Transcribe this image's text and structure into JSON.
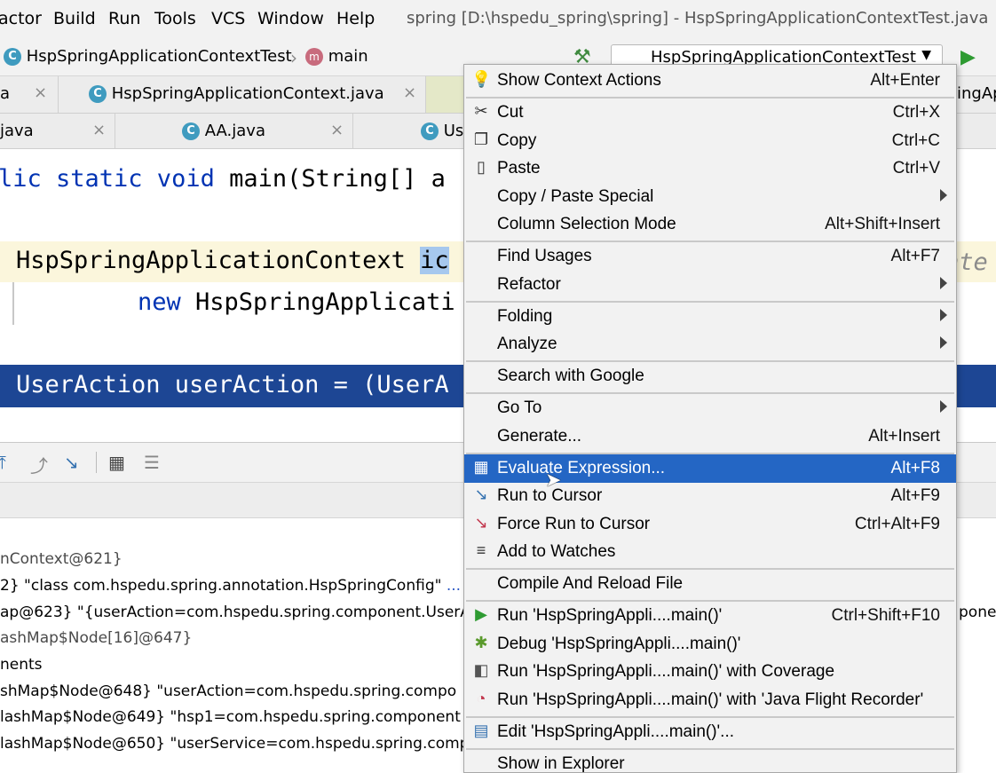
{
  "menubar": {
    "items": [
      "actor",
      "Build",
      "Run",
      "Tools",
      "VCS",
      "Window",
      "Help"
    ],
    "title": "spring [D:\\hspedu_spring\\spring] - HspSpringApplicationContextTest.java"
  },
  "navbar": {
    "crumb1": "HspSpringApplicationContextTest",
    "crumb2": "main",
    "run_config": "HspSpringApplicationContextTest"
  },
  "tabs_row1": [
    {
      "label": "a"
    },
    {
      "label": "HspSpringApplicationContext.java"
    },
    {
      "label": ""
    },
    {
      "label": "ingApp"
    }
  ],
  "tabs_row2": [
    {
      "label": "java"
    },
    {
      "label": "AA.java"
    },
    {
      "label": "Us"
    }
  ],
  "editor": {
    "line1_kw": "lic static void ",
    "line1_rest": "main(String[] a",
    "line2_cls": "HspSpringApplicationContext ",
    "line2_sel": "ic",
    "line2_hint": "nte",
    "line3_kw": "new ",
    "line3_rest": "HspSpringApplicati",
    "line3_end": ";",
    "line4": "UserAction userAction = (UserA",
    "line4_end": ";"
  },
  "variables": [
    {
      "text": "nContext@621}",
      "extra": ""
    },
    {
      "text": "2} \"class com.hspedu.spring.annotation.HspSpringConfig\"",
      "extra": "..."
    },
    {
      "text": "ap@623} \"{userAction=com.hspedu.spring.component.UserA",
      "extra": "pone"
    },
    {
      "text": "ashMap$Node[16]@647}",
      "extra": ""
    },
    {
      "text": "nents",
      "extra": ""
    },
    {
      "text": "shMap$Node@648} \"userAction=com.hspedu.spring.compo",
      "extra": ""
    },
    {
      "text": "lashMap$Node@649} \"hsp1=com.hspedu.spring.component",
      "extra": ""
    },
    {
      "text": "lashMap$Node@650} \"userService=com.hspedu.spring.comp",
      "extra": ""
    }
  ],
  "context_menu": [
    {
      "label": "Show Context Actions",
      "shortcut": "Alt+Enter",
      "icon": "lightbulb-icon"
    },
    {
      "label": "Cut",
      "shortcut": "Ctrl+X",
      "icon": "scissors-icon"
    },
    {
      "label": "Copy",
      "shortcut": "Ctrl+C",
      "icon": "copy-icon"
    },
    {
      "label": "Paste",
      "shortcut": "Ctrl+V",
      "icon": "paste-icon"
    },
    {
      "label": "Copy / Paste Special",
      "shortcut": "",
      "icon": "",
      "submenu": true
    },
    {
      "label": "Column Selection Mode",
      "shortcut": "Alt+Shift+Insert",
      "icon": ""
    },
    {
      "label": "Find Usages",
      "shortcut": "Alt+F7",
      "icon": ""
    },
    {
      "label": "Refactor",
      "shortcut": "",
      "icon": "",
      "submenu": true
    },
    {
      "label": "Folding",
      "shortcut": "",
      "icon": "",
      "submenu": true
    },
    {
      "label": "Analyze",
      "shortcut": "",
      "icon": "",
      "submenu": true
    },
    {
      "label": "Search with Google",
      "shortcut": "",
      "icon": ""
    },
    {
      "label": "Go To",
      "shortcut": "",
      "icon": "",
      "submenu": true
    },
    {
      "label": "Generate...",
      "shortcut": "Alt+Insert",
      "icon": ""
    },
    {
      "label": "Evaluate Expression...",
      "shortcut": "Alt+F8",
      "icon": "calculator-icon",
      "active": true
    },
    {
      "label": "Run to Cursor",
      "shortcut": "Alt+F9",
      "icon": "run-to-cursor-icon"
    },
    {
      "label": "Force Run to Cursor",
      "shortcut": "Ctrl+Alt+F9",
      "icon": "force-run-to-cursor-icon"
    },
    {
      "label": "Add to Watches",
      "shortcut": "",
      "icon": "watches-icon"
    },
    {
      "label": "Compile And Reload File",
      "shortcut": "",
      "icon": ""
    },
    {
      "label": "Run 'HspSpringAppli....main()'",
      "shortcut": "Ctrl+Shift+F10",
      "icon": "run-icon"
    },
    {
      "label": "Debug 'HspSpringAppli....main()'",
      "shortcut": "",
      "icon": "debug-icon"
    },
    {
      "label": "Run 'HspSpringAppli....main()' with Coverage",
      "shortcut": "",
      "icon": "coverage-icon"
    },
    {
      "label": "Run 'HspSpringAppli....main()' with 'Java Flight Recorder'",
      "shortcut": "",
      "icon": "flight-recorder-icon"
    },
    {
      "label": "Edit 'HspSpringAppli....main()'...",
      "shortcut": "",
      "icon": "edit-config-icon"
    },
    {
      "label": "Show in Explorer",
      "shortcut": "",
      "icon": ""
    }
  ],
  "colors": {
    "menu_highlight": "#2466c4",
    "editor_selection": "#1d4694",
    "keyword": "#0033b3",
    "class_icon": "#3f9bbf"
  }
}
